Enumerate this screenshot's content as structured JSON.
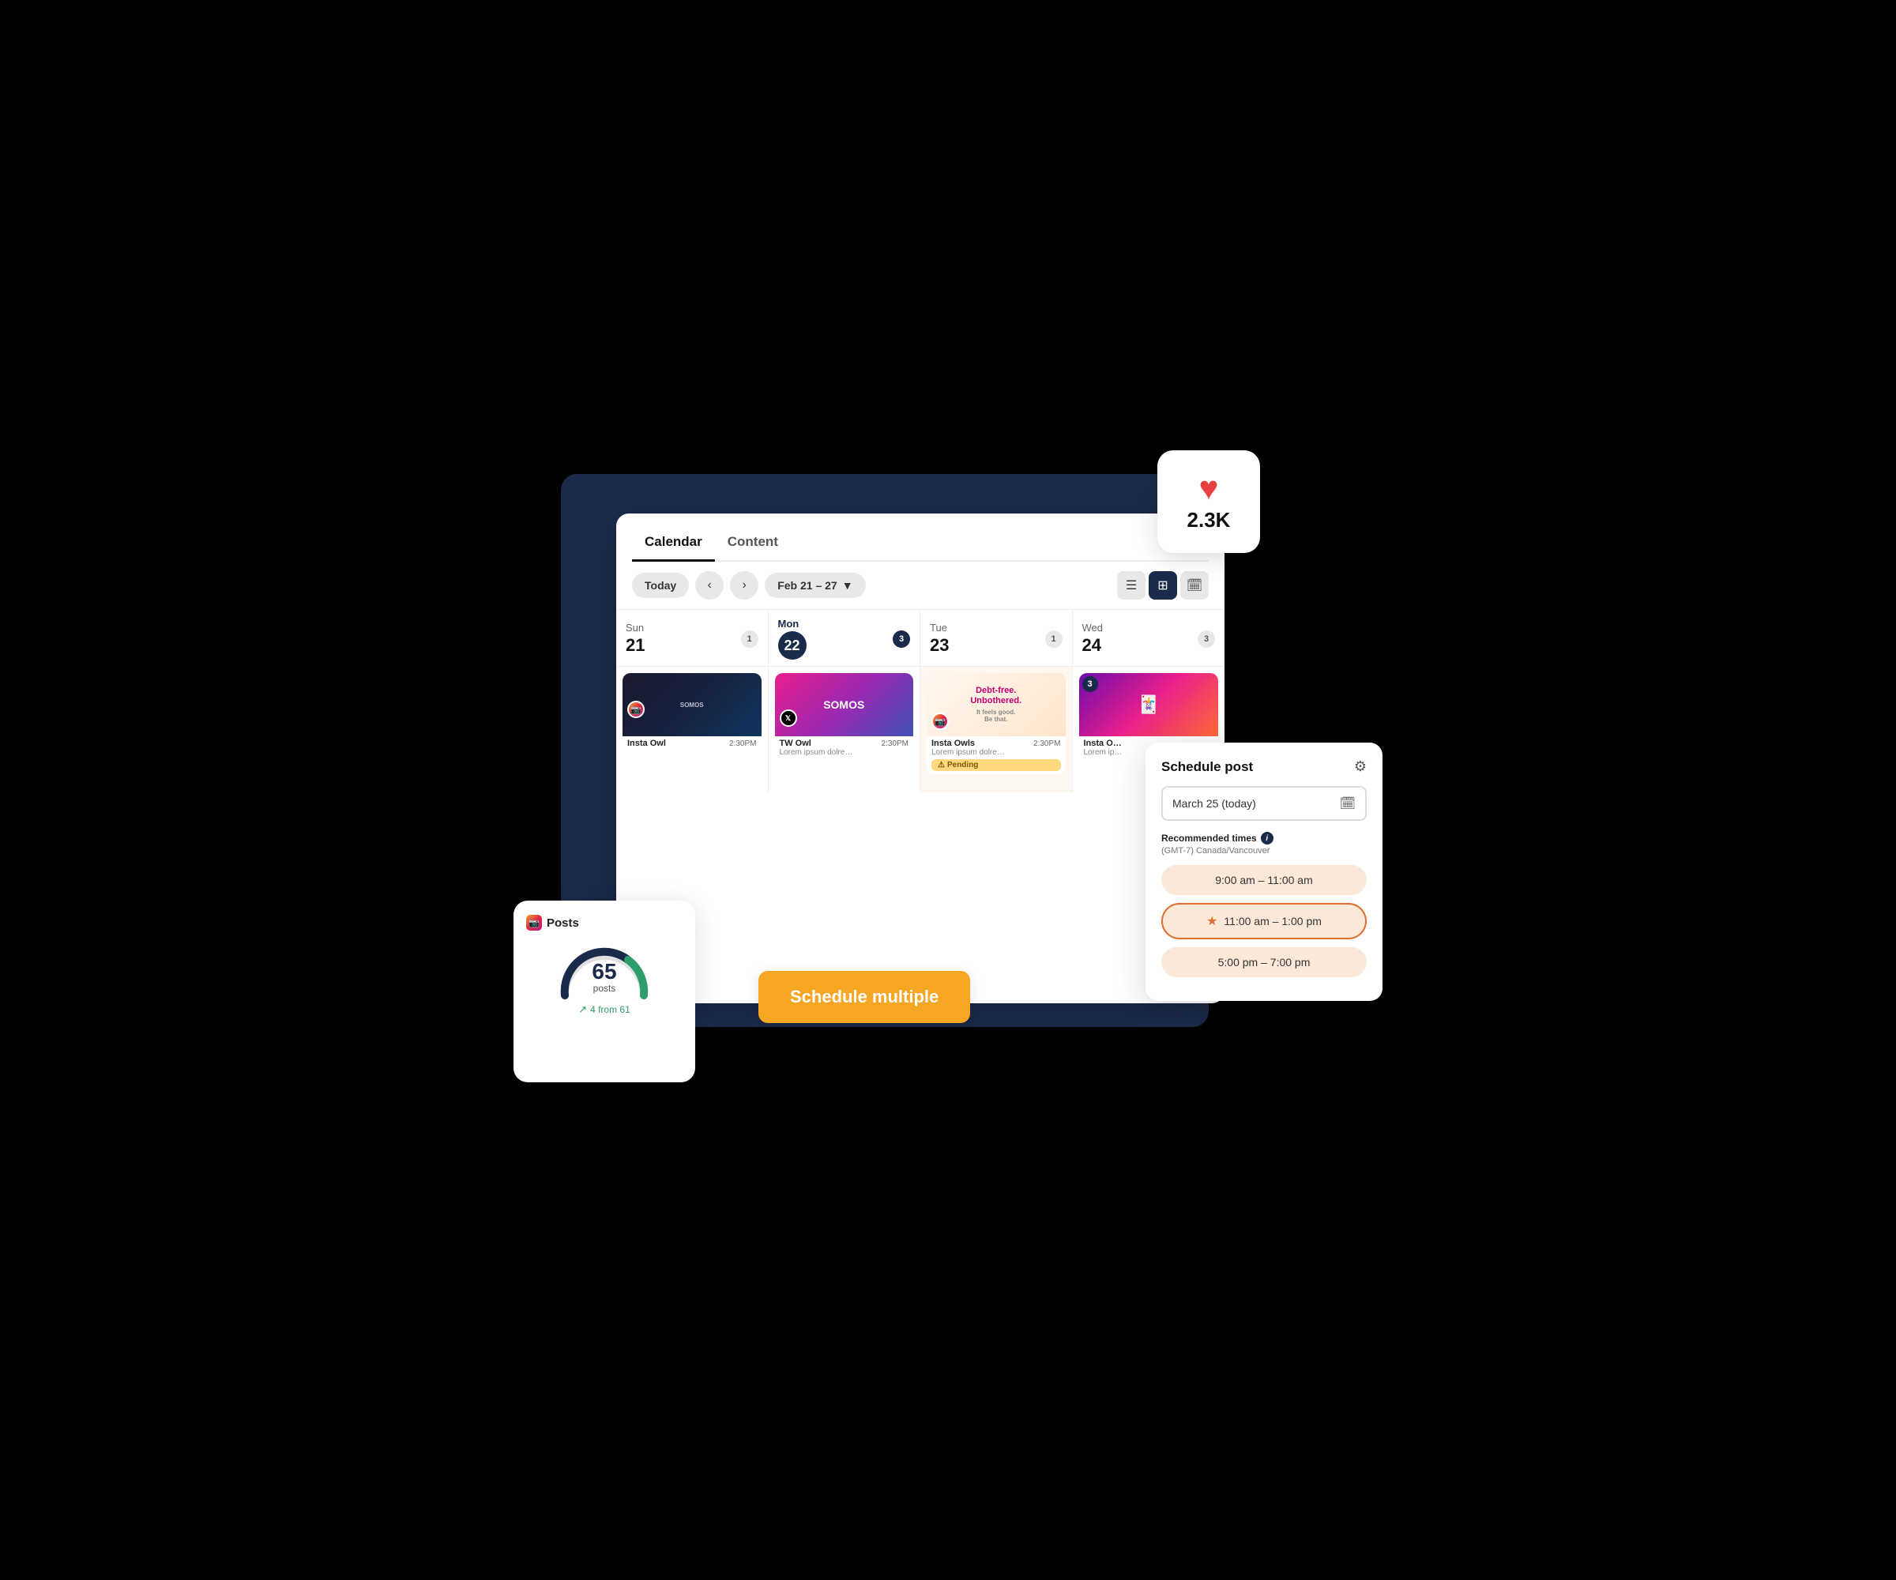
{
  "heart_badge": {
    "count": "2.3K"
  },
  "calendar": {
    "tab_calendar": "Calendar",
    "tab_content": "Content",
    "today_btn": "Today",
    "prev_arrow": "‹",
    "next_arrow": "›",
    "date_range": "Feb 21 – 27",
    "view_list": "☰",
    "view_grid": "⊞",
    "view_month": "📅",
    "days": [
      {
        "name": "Sun",
        "number": "21",
        "badge": "1",
        "badge_type": "normal"
      },
      {
        "name": "Mon",
        "number": "22",
        "badge": "3",
        "badge_type": "blue",
        "circle": true
      },
      {
        "name": "Tue",
        "number": "23",
        "badge": "1",
        "badge_type": "normal"
      },
      {
        "name": "Wed",
        "number": "24",
        "badge": "3",
        "badge_type": "normal"
      }
    ],
    "posts": {
      "sun": [
        {
          "platform": "ig",
          "title": "Insta Owl",
          "time": "2:30PM",
          "desc": "",
          "pending": false
        }
      ],
      "mon": [
        {
          "platform": "tw",
          "title": "TW Owl",
          "time": "2:30PM",
          "desc": "Lorem ipsum dolre…",
          "pending": false
        }
      ],
      "tue": [
        {
          "platform": "ig",
          "title": "Insta Owls",
          "time": "2:30PM",
          "desc": "Lorem ipsum dolre…",
          "pending": true
        }
      ],
      "wed": [
        {
          "platform": "ig",
          "title": "Insta O…",
          "time": "",
          "desc": "Lorem ip…",
          "pending": false,
          "badge3": true
        }
      ]
    }
  },
  "posts_widget": {
    "label": "Posts",
    "count": "65",
    "sub": "posts",
    "from_text": "4 from 61"
  },
  "schedule_multiple": {
    "label": "Schedule multiple"
  },
  "schedule_panel": {
    "title": "Schedule post",
    "date": "March 25 (today)",
    "recommended_label": "Recommended times",
    "timezone": "(GMT-7) Canada/Vancouver",
    "times": [
      {
        "label": "9:00 am – 11:00 am",
        "selected": false
      },
      {
        "label": "11:00 am – 1:00 pm",
        "selected": true
      },
      {
        "label": "5:00 pm – 7:00 pm",
        "selected": false
      }
    ]
  }
}
